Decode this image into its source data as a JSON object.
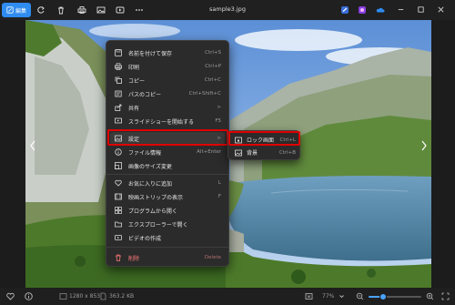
{
  "titlebar": {
    "edit_label": "編集",
    "file_name": "sample3.jpg"
  },
  "context_menu": {
    "items": [
      {
        "label": "名前を付けて保存",
        "shortcut": "Ctrl+S",
        "icon": "save-as-icon"
      },
      {
        "label": "印刷",
        "shortcut": "Ctrl+P",
        "icon": "print-icon"
      },
      {
        "label": "コピー",
        "shortcut": "Ctrl+C",
        "icon": "copy-icon"
      },
      {
        "label": "パスのコピー",
        "shortcut": "Ctrl+Shift+C",
        "icon": "copy-path-icon"
      },
      {
        "label": "共有",
        "shortcut": ">",
        "icon": "share-icon"
      },
      {
        "label": "スライドショーを開始する",
        "shortcut": "F5",
        "icon": "slideshow-icon"
      },
      {
        "label": "設定",
        "shortcut": ">",
        "icon": "set-as-icon"
      },
      {
        "label": "ファイル情報",
        "shortcut": "Alt+Enter",
        "icon": "info-icon"
      },
      {
        "label": "画像のサイズ変更",
        "shortcut": "",
        "icon": "resize-icon"
      },
      {
        "label": "お気に入りに追加",
        "shortcut": "L",
        "icon": "heart-icon"
      },
      {
        "label": "映画ストリップの表示",
        "shortcut": "F",
        "icon": "filmstrip-icon"
      },
      {
        "label": "プログラムから開く",
        "shortcut": "",
        "icon": "open-with-icon"
      },
      {
        "label": "エクスプローラーで開く",
        "shortcut": "",
        "icon": "folder-icon"
      },
      {
        "label": "ビデオの作成",
        "shortcut": "",
        "icon": "video-icon"
      },
      {
        "label": "削除",
        "shortcut": "Delete",
        "icon": "trash-icon"
      }
    ]
  },
  "submenu": {
    "items": [
      {
        "label": "ロック画面",
        "shortcut": "Ctrl+L",
        "icon": "lock-screen-icon"
      },
      {
        "label": "背景",
        "shortcut": "Ctrl+B",
        "icon": "background-icon"
      }
    ]
  },
  "statusbar": {
    "dimensions": "1280 x 853",
    "file_size": "363.2 KB",
    "zoom_level": "77%",
    "zoom_value": 0.28
  },
  "colors": {
    "accent": "#2f8cf0",
    "highlight": "#e00000"
  }
}
